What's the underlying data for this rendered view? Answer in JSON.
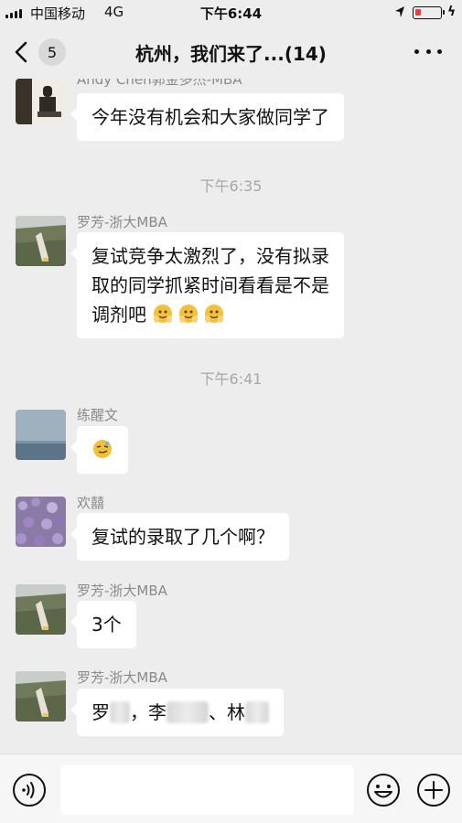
{
  "status_bar": {
    "carrier": "中国移动",
    "network": "4G",
    "time": "下午6:44"
  },
  "nav": {
    "unread_count": "5",
    "title": "杭州，我们来了...(14)"
  },
  "messages": [
    {
      "sender": "Andy Chen郭金多杰-MBA",
      "text": "今年没有机会和大家做同学了"
    },
    {
      "timestamp": "下午6:35"
    },
    {
      "sender": "罗芳-浙大MBA",
      "lines": [
        "复试竞争太激烈了，没有拟录",
        "取的同学抓紧时间看看是不是",
        "调剂吧"
      ],
      "emoji": "clapping-face-emoji"
    },
    {
      "timestamp": "下午6:41"
    },
    {
      "sender": "练醒文",
      "emoji": "smirk-face-emoji"
    },
    {
      "sender": "欢囍",
      "text": "复试的录取了几个啊？"
    },
    {
      "sender": "罗芳-浙大MBA",
      "text": "3个"
    },
    {
      "sender": "罗芳-浙大MBA",
      "segments": [
        "罗",
        "，李",
        "、林"
      ]
    }
  ],
  "input": {
    "placeholder": ""
  },
  "colors": {
    "background": "#ededed",
    "bubble": "#ffffff",
    "timestamp": "#a7a7a7",
    "sender": "#8a8a8a",
    "battery_low": "#e8403a"
  },
  "icons": [
    "back-chevron-icon",
    "more-icon",
    "voice-icon",
    "emoji-icon",
    "plus-icon",
    "location-arrow-icon",
    "battery-icon"
  ]
}
